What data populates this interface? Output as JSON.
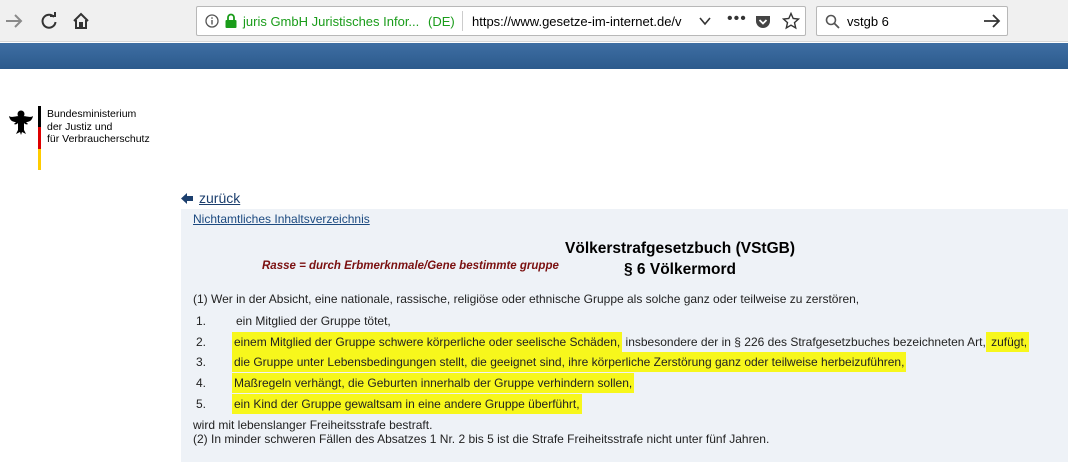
{
  "browser": {
    "site_identity": "juris GmbH Juristisches Infor...",
    "country": "(DE)",
    "url": "https://www.gesetze-im-internet.de/v",
    "page_actions": "•••",
    "search_query": "vstgb 6"
  },
  "header": {
    "ministry_lines": [
      "Bundesministerium",
      "der Justiz und",
      "für Verbraucherschutz"
    ],
    "flag_colors": [
      "#000000",
      "#dd0000",
      "#ffcc00"
    ],
    "band_color": "#2f5d91"
  },
  "nav": {
    "back_label": "zurück",
    "toc_label": "Nichtamtliches Inhaltsverzeichnis"
  },
  "annotation": "Rasse = durch Erbmerknmale/Gene bestimmte gruppe",
  "law": {
    "title": "Völkerstrafgesetzbuch (VStGB)",
    "section": "§ 6 Völkermord",
    "paragraph1": "(1) Wer in der Absicht, eine nationale, rassische, religiöse oder ethnische Gruppe als solche ganz oder teilweise zu zerstören,",
    "items": [
      {
        "num": "1.",
        "text": "ein Mitglied der Gruppe tötet,"
      },
      {
        "num": "2.",
        "text_highlight": "einem Mitglied der Gruppe schwere körperliche oder seelische Schäden,",
        "text_rest": " insbesondere der in § 226 des Strafgesetzbuches bezeichneten Art,",
        "text_highlight2": " zufügt,"
      },
      {
        "num": "3.",
        "text": "die Gruppe unter Lebensbedingungen stellt, die geeignet sind, ihre körperliche Zerstörung ganz oder teilweise herbeizuführen,"
      },
      {
        "num": "4.",
        "text": "Maßregeln verhängt, die Geburten innerhalb der Gruppe verhindern sollen,"
      },
      {
        "num": "5.",
        "text": "ein Kind der Gruppe gewaltsam in eine andere Gruppe überführt,"
      }
    ],
    "closing": "wird mit lebenslanger Freiheitsstrafe bestraft.",
    "paragraph2": "(2) In minder schweren Fällen des Absatzes 1 Nr. 2 bis 5 ist die Strafe Freiheitsstrafe nicht unter fünf Jahren."
  },
  "colors": {
    "highlight": "#f7f71c",
    "link": "#1c4a80",
    "annotation": "#7a1010"
  }
}
